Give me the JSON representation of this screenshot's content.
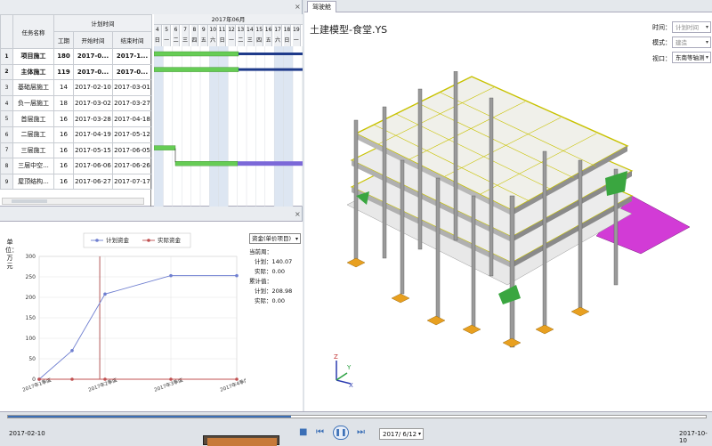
{
  "gantt": {
    "headers": {
      "task_name": "任务名称",
      "plan_time": "计划时间",
      "duration": "工期",
      "start": "开始时间",
      "end": "结束时间"
    },
    "rows": [
      {
        "idx": "1",
        "name": "项目施工",
        "duration": "180",
        "start": "2017-0...",
        "end": "2017-1...",
        "summary": true
      },
      {
        "idx": "2",
        "name": "主体施工",
        "duration": "119",
        "start": "2017-0...",
        "end": "2017-0...",
        "summary": true
      },
      {
        "idx": "3",
        "name": "基础层施工",
        "duration": "14",
        "start": "2017-02-10",
        "end": "2017-03-01",
        "summary": false
      },
      {
        "idx": "4",
        "name": "负一层施工",
        "duration": "18",
        "start": "2017-03-02",
        "end": "2017-03-27",
        "summary": false
      },
      {
        "idx": "5",
        "name": "首层施工",
        "duration": "16",
        "start": "2017-03-28",
        "end": "2017-04-18",
        "summary": false
      },
      {
        "idx": "6",
        "name": "二层施工",
        "duration": "16",
        "start": "2017-04-19",
        "end": "2017-05-12",
        "summary": false
      },
      {
        "idx": "7",
        "name": "三层施工",
        "duration": "16",
        "start": "2017-05-15",
        "end": "2017-06-05",
        "summary": false
      },
      {
        "idx": "8",
        "name": "三层中空...",
        "duration": "16",
        "start": "2017-06-06",
        "end": "2017-06-26",
        "summary": false
      },
      {
        "idx": "9",
        "name": "屋顶结构...",
        "duration": "16",
        "start": "2017-06-27",
        "end": "2017-07-17",
        "summary": false
      }
    ],
    "month_label": "2017年06月",
    "days": [
      "4",
      "5",
      "6",
      "7",
      "8",
      "9",
      "10",
      "11",
      "12",
      "13",
      "14",
      "15",
      "16",
      "17",
      "18",
      "19"
    ],
    "weekdays": [
      "日",
      "一",
      "二",
      "三",
      "四",
      "五",
      "六",
      "日",
      "一",
      "二",
      "三",
      "四",
      "五",
      "六",
      "日",
      "一"
    ],
    "close": "×"
  },
  "chart_panel": {
    "ylabel": "单位：万元",
    "select": "资金(单价项目)",
    "current_week": "当前周：",
    "plan_week": "计划：140.07",
    "actual_week": "实际：0.00",
    "cumulative": "累计值：",
    "plan_cum": "计划：208.98",
    "actual_cum": "实际：0.00",
    "close": "×"
  },
  "chart_data": {
    "type": "line",
    "categories": [
      "2017年1季度",
      "2017年2季度",
      "2017年3季度",
      "2017年4季度"
    ],
    "x_points": [
      0,
      0.5,
      1,
      2,
      3
    ],
    "series": [
      {
        "name": "计划资金",
        "values": [
          0,
          70,
          208,
          253,
          253
        ],
        "color": "#6f7fd0"
      },
      {
        "name": "实际资金",
        "values": [
          0,
          0,
          0,
          0,
          0
        ],
        "color": "#c05050"
      }
    ],
    "ylim": [
      0,
      300
    ],
    "yticks": [
      0,
      50,
      100,
      150,
      200,
      250,
      300
    ],
    "current_marker_x": 0.92,
    "grid": true,
    "legend": "top"
  },
  "viewer": {
    "tab": "驾驶舱",
    "title": "土建模型-食堂.YS",
    "time_label": "时间：",
    "time_value": "计划时间",
    "mode_label": "模式：",
    "mode_value": "建造",
    "view_label": "视口：",
    "view_value": "东南等轴测",
    "axis_z": "Z",
    "axis_y": "Y",
    "axis_x": "X"
  },
  "playback": {
    "start_date": "2017-02-10",
    "end_date": "2017-10-10",
    "current_date": "2017/ 6/12",
    "progress": 0.51,
    "stop_icon": "■",
    "prev_icon": "⏮",
    "pause_icon": "❚❚",
    "next_icon": "⏭"
  }
}
